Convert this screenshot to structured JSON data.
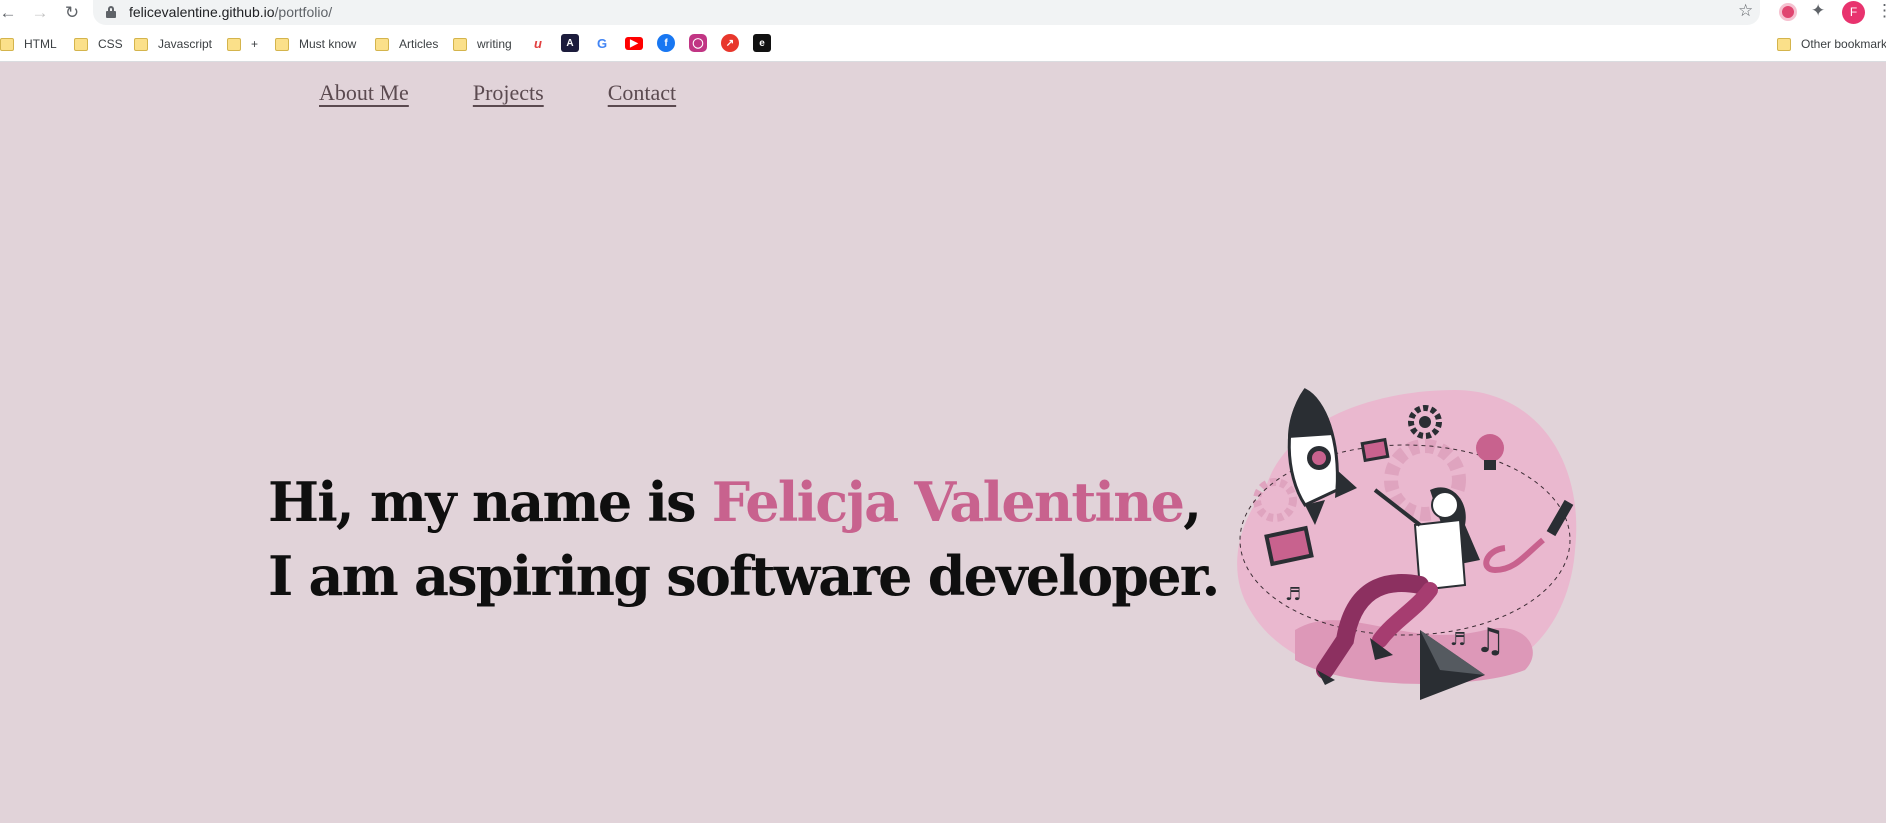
{
  "browser": {
    "url_host": "felicevalentine.github.io",
    "url_path": "/portfolio/",
    "profile_initial": "F",
    "nav_icons": [
      "back-icon",
      "forward-icon",
      "reload-icon"
    ]
  },
  "bookmarks": {
    "folders": [
      "HTML",
      "CSS",
      "Javascript",
      "+",
      "Must know",
      "Articles",
      "writing"
    ],
    "other": "Other bookmarks",
    "favicons": [
      "u-icon",
      "a-icon",
      "google-icon",
      "youtube-icon",
      "facebook-icon",
      "instagram-icon",
      "chart-icon",
      "e-icon"
    ]
  },
  "site_nav": {
    "about": "About Me",
    "projects": "Projects",
    "contact": "Contact"
  },
  "hero": {
    "line1_prefix": "Hi, my name is ",
    "name": "Felicja Valentine",
    "line1_suffix": ",",
    "line2": "I am aspiring software developer."
  },
  "colors": {
    "page_bg": "#e1d3d9",
    "accent": "#c8628e",
    "heading": "#0f0f0f"
  }
}
